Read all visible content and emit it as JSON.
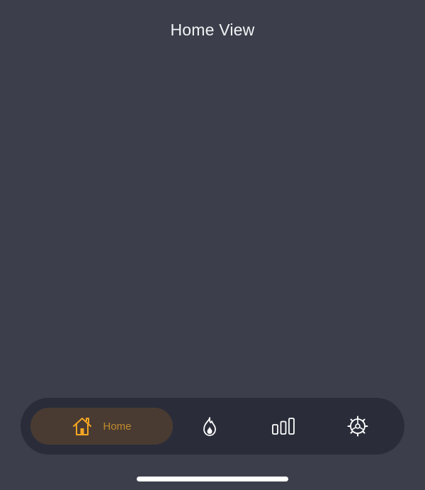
{
  "header": {
    "title": "Home View"
  },
  "tabbar": {
    "tabs": [
      {
        "id": "home",
        "label": "Home",
        "icon": "house-icon",
        "selected": true
      },
      {
        "id": "streak",
        "label": "",
        "icon": "flame-icon",
        "selected": false
      },
      {
        "id": "stats",
        "label": "",
        "icon": "bar-chart-icon",
        "selected": false
      },
      {
        "id": "settings",
        "label": "",
        "icon": "gear-icon",
        "selected": false
      }
    ]
  },
  "colors": {
    "background": "#3c3f4b",
    "tabbar_background": "#2a2d39",
    "active_pill": "#4a3b32",
    "accent": "#f5a623",
    "icon_default": "#ffffff"
  }
}
